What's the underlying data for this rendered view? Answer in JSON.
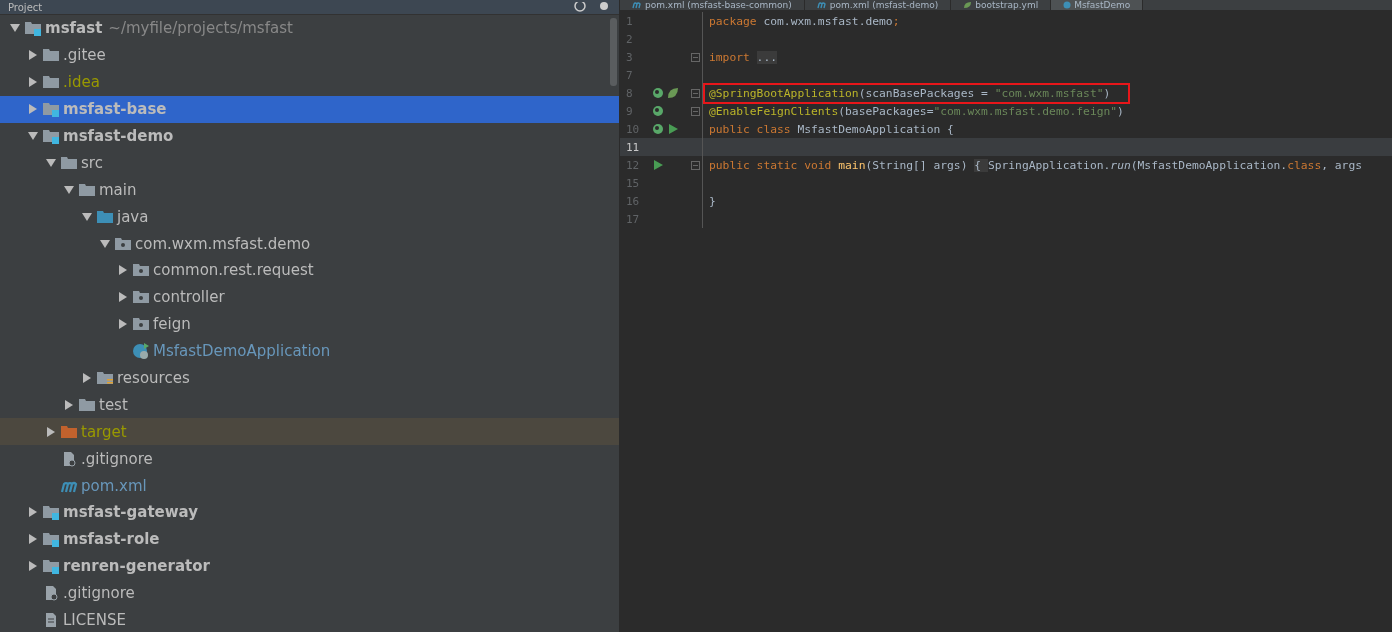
{
  "project_panel": {
    "title": "Project",
    "tree": [
      {
        "label": "msfast",
        "path": "~/myfile/projects/msfast",
        "kind": "module",
        "color": "#bbbbbb",
        "selected": false,
        "expanded": true,
        "children": [
          {
            "label": ".gitee",
            "kind": "folder",
            "color": "#bbbbbb",
            "selected": false,
            "expanded": false
          },
          {
            "label": ".idea",
            "kind": "folder",
            "color": "#999900",
            "selected": false,
            "expanded": false
          },
          {
            "label": "msfast-base",
            "kind": "module",
            "color": "#bbbbbb",
            "selected": true,
            "expanded": false
          },
          {
            "label": "msfast-demo",
            "kind": "module",
            "color": "#bbbbbb",
            "selected": false,
            "expanded": true,
            "children": [
              {
                "label": "src",
                "kind": "folder",
                "color": "#bbbbbb",
                "selected": false,
                "expanded": true,
                "children": [
                  {
                    "label": "main",
                    "kind": "folder",
                    "color": "#bbbbbb",
                    "selected": false,
                    "expanded": true,
                    "children": [
                      {
                        "label": "java",
                        "kind": "source-folder",
                        "color": "#bbbbbb",
                        "selected": false,
                        "expanded": true,
                        "children": [
                          {
                            "label": "com.wxm.msfast.demo",
                            "kind": "package",
                            "color": "#bbbbbb",
                            "selected": false,
                            "expanded": true,
                            "children": [
                              {
                                "label": "common.rest.request",
                                "kind": "package",
                                "color": "#bbbbbb",
                                "selected": false,
                                "expanded": false
                              },
                              {
                                "label": "controller",
                                "kind": "package",
                                "color": "#bbbbbb",
                                "selected": false,
                                "expanded": false
                              },
                              {
                                "label": "feign",
                                "kind": "package",
                                "color": "#bbbbbb",
                                "selected": false,
                                "expanded": false
                              },
                              {
                                "label": "MsfastDemoApplication",
                                "kind": "class",
                                "color": "#6897bb",
                                "selected": false
                              }
                            ]
                          }
                        ]
                      },
                      {
                        "label": "resources",
                        "kind": "resource-folder",
                        "color": "#bbbbbb",
                        "selected": false,
                        "expanded": false
                      }
                    ]
                  },
                  {
                    "label": "test",
                    "kind": "folder",
                    "color": "#bbbbbb",
                    "selected": false,
                    "expanded": false
                  }
                ]
              },
              {
                "label": "target",
                "kind": "excluded-folder",
                "color": "#999900",
                "selected": false,
                "expanded": false
              },
              {
                "label": ".gitignore",
                "kind": "ignore-file",
                "color": "#bbbbbb",
                "selected": false
              },
              {
                "label": "pom.xml",
                "kind": "maven",
                "color": "#6897bb",
                "selected": false
              }
            ]
          },
          {
            "label": "msfast-gateway",
            "kind": "module",
            "color": "#bbbbbb",
            "selected": false,
            "expanded": false
          },
          {
            "label": "msfast-role",
            "kind": "module",
            "color": "#bbbbbb",
            "selected": false,
            "expanded": false
          },
          {
            "label": "renren-generator",
            "kind": "module",
            "color": "#bbbbbb",
            "selected": false,
            "expanded": false
          },
          {
            "label": ".gitignore",
            "kind": "ignore-file",
            "color": "#bbbbbb",
            "selected": false
          },
          {
            "label": "LICENSE",
            "kind": "text-file",
            "color": "#bbbbbb",
            "selected": false
          }
        ]
      }
    ]
  },
  "editor": {
    "tabs": [
      {
        "label": "pom.xml (msfast-base-common)",
        "kind": "maven",
        "selected": false
      },
      {
        "label": "pom.xml (msfast-demo)",
        "kind": "maven",
        "selected": false
      },
      {
        "label": "bootstrap.yml",
        "kind": "yaml",
        "selected": false
      },
      {
        "label": "MsfastDemo",
        "kind": "class",
        "selected": true
      }
    ],
    "lines": [
      {
        "number": "1",
        "current": false,
        "fold": false,
        "tokens": [
          {
            "text": "package ",
            "kind": "keyword"
          },
          {
            "text": "com.wxm.msfast.demo",
            "kind": "plain"
          },
          {
            "text": ";",
            "kind": "keyword"
          }
        ]
      },
      {
        "number": "2",
        "current": false,
        "fold": false
      },
      {
        "number": "3",
        "current": false,
        "fold": true,
        "tokens": [
          {
            "text": "import ",
            "kind": "keyword"
          },
          {
            "text": "...",
            "kind": "folded"
          }
        ]
      },
      {
        "number": "7",
        "current": false,
        "fold": false
      },
      {
        "number": "8",
        "current": false,
        "boxed": true,
        "gutter": [
          {
            "kind": "bean"
          },
          {
            "kind": "spring"
          }
        ],
        "fold": true,
        "tokens": [
          {
            "text": "@SpringBootApplication",
            "kind": "annotation"
          },
          {
            "text": "(scanBasePackages = ",
            "kind": "plain"
          },
          {
            "text": "\"com.wxm.msfast\"",
            "kind": "string"
          },
          {
            "text": ")",
            "kind": "plain"
          }
        ]
      },
      {
        "number": "9",
        "current": false,
        "gutter": [
          {
            "kind": "bean"
          }
        ],
        "fold": true,
        "tokens": [
          {
            "text": "@EnableFeignClients",
            "kind": "annotation"
          },
          {
            "text": "(basePackages=",
            "kind": "plain"
          },
          {
            "text": "\"com.wxm.msfast.demo.feign\"",
            "kind": "string"
          },
          {
            "text": ")",
            "kind": "plain"
          }
        ]
      },
      {
        "number": "10",
        "current": false,
        "gutter": [
          {
            "kind": "bean"
          },
          {
            "kind": "run"
          }
        ],
        "fold": false,
        "tokens": [
          {
            "text": "public class ",
            "kind": "keyword"
          },
          {
            "text": "MsfastDemoApplication {",
            "kind": "plain"
          }
        ]
      },
      {
        "number": "11",
        "current": true,
        "fold": false
      },
      {
        "number": "12",
        "current": false,
        "gutter": [
          {
            "kind": "run"
          }
        ],
        "fold": true,
        "tokens": [
          {
            "text": "    public static void ",
            "kind": "keyword"
          },
          {
            "text": "main",
            "kind": "method"
          },
          {
            "text": "(String[] args) ",
            "kind": "plain"
          },
          {
            "text": "{ ",
            "kind": "folded"
          },
          {
            "text": "SpringApplication.",
            "kind": "plain"
          },
          {
            "text": "run",
            "kind": "italic"
          },
          {
            "text": "(MsfastDemoApplication.",
            "kind": "plain"
          },
          {
            "text": "class",
            "kind": "keyword"
          },
          {
            "text": ", args",
            "kind": "plain"
          }
        ]
      },
      {
        "number": "15",
        "current": false,
        "fold": false
      },
      {
        "number": "16",
        "current": false,
        "fold": false,
        "tokens": [
          {
            "text": "}",
            "kind": "plain"
          }
        ]
      },
      {
        "number": "17",
        "current": false,
        "fold": false
      }
    ]
  }
}
